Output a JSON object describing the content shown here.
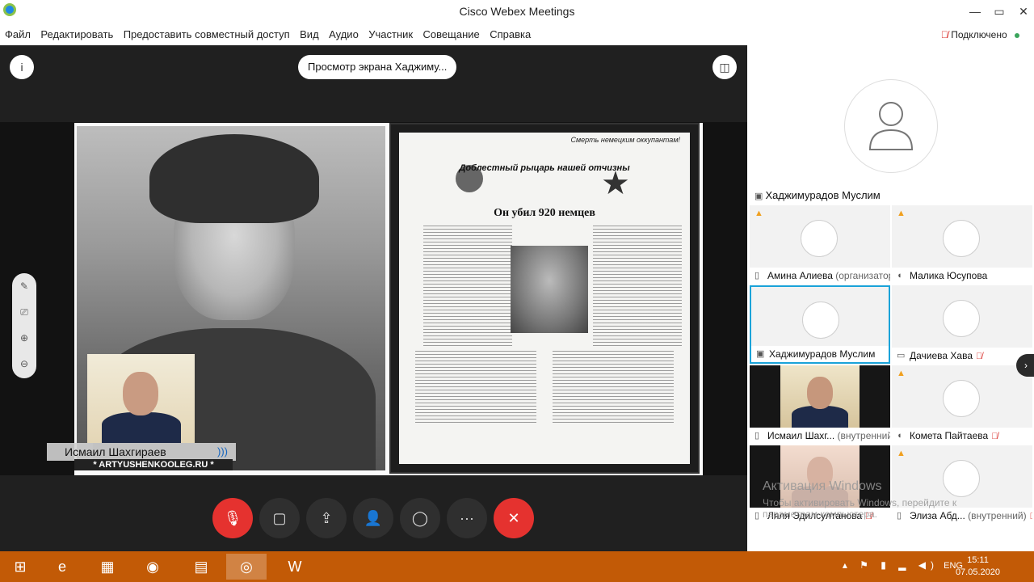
{
  "window": {
    "title": "Cisco Webex Meetings",
    "minimize": "—",
    "maximize": "▭",
    "close": "✕"
  },
  "menu": [
    "Файл",
    "Редактировать",
    "Предоставить совместный доступ",
    "Вид",
    "Аудио",
    "Участник",
    "Совещание",
    "Справка"
  ],
  "status": {
    "text": "Подключено",
    "dot_color": "#3ba55c"
  },
  "share": {
    "label": "Просмотр экрана Хаджиму...",
    "info_icon": "i",
    "layout_icon": "◫"
  },
  "self_view": {
    "name": "Исмаил Шахгираев",
    "audio_icon": ")))",
    "watermark": "* ARTYUSHENKOOLEG.RU *"
  },
  "newspaper": {
    "corner": "Смерть немецким оккупантам!",
    "headline1": "Доблестный рыцарь нашей отчизны",
    "headline2": "Он убил 920 немцев"
  },
  "side_tools": [
    "✎",
    "⎚",
    "⊕",
    "⊖"
  ],
  "controls": [
    {
      "name": "mute-button",
      "icon": "🎙"
    },
    {
      "name": "video-button",
      "icon": "▢"
    },
    {
      "name": "share-button",
      "icon": "⇪"
    },
    {
      "name": "participants-button",
      "icon": "👤"
    },
    {
      "name": "chat-button",
      "icon": "◯"
    },
    {
      "name": "more-button",
      "icon": "···"
    },
    {
      "name": "leave-button",
      "icon": "✕"
    }
  ],
  "active_speaker": {
    "name": "Хаджимурадов Муслим"
  },
  "participants": [
    {
      "name": "Амина Алиева",
      "tag": " (организатор)",
      "warn": true,
      "muted": false,
      "video": "avatar"
    },
    {
      "name": "Малика Юсупова",
      "tag": "",
      "warn": true,
      "muted": false,
      "video": "avatar"
    },
    {
      "name": "Хаджимурадов Муслим",
      "tag": "",
      "warn": false,
      "muted": false,
      "video": "avatar"
    },
    {
      "name": "Дачиева Хава",
      "tag": "",
      "warn": false,
      "muted": true,
      "video": "avatar"
    },
    {
      "name": "Исмаил Шахг...",
      "tag": " (внутренний)",
      "warn": false,
      "muted": false,
      "video": "person"
    },
    {
      "name": "Комета Пайтаева",
      "tag": "",
      "warn": true,
      "muted": true,
      "video": "avatar"
    },
    {
      "name": "Ляля Эдилсултанова",
      "tag": "",
      "warn": false,
      "muted": true,
      "video": "person-light"
    },
    {
      "name": "Элиза Абд...",
      "tag": " (внутренний)",
      "warn": true,
      "muted": true,
      "video": "avatar"
    }
  ],
  "activation": {
    "line1": "Активация Windows",
    "line2": "Чтобы активировать Windows, перейдите к параметрам компьютера."
  },
  "taskbar": {
    "apps": [
      "⊞",
      "e",
      "▦",
      "◉",
      "▤",
      "◎",
      "W"
    ],
    "lang": "ENG",
    "time": "15:11",
    "date": "07.05.2020"
  }
}
